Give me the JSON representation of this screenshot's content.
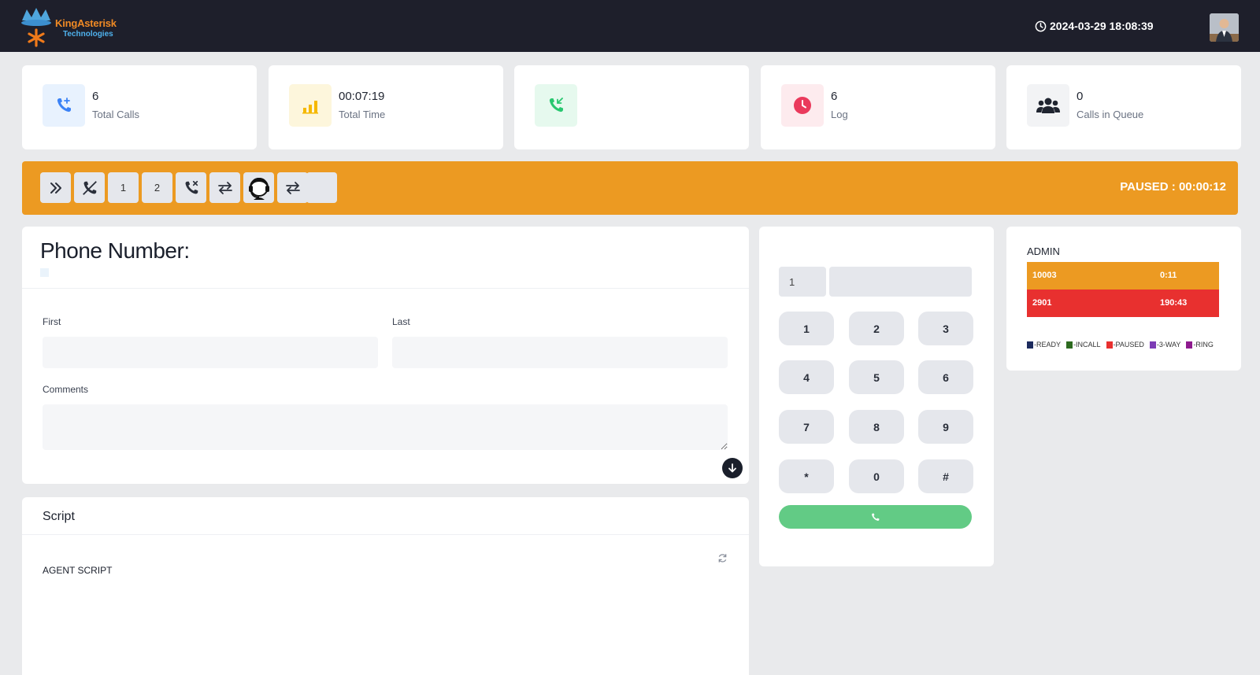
{
  "header": {
    "logo_brand": "KingAsterisk",
    "logo_sub": "Technologies",
    "datetime": "2024-03-29 18:08:39"
  },
  "stats": [
    {
      "value": "6",
      "label": "Total Calls",
      "icon": "phone-plus-icon",
      "color": "#3b82f6"
    },
    {
      "value": "00:07:19",
      "label": "Total Time",
      "icon": "bar-chart-icon",
      "color": "#f5b800"
    },
    {
      "value": "",
      "label": "",
      "icon": "incoming-call-icon",
      "color": "#28c76f"
    },
    {
      "value": "6",
      "label": "Log",
      "icon": "clock-icon",
      "color": "#ea3a5c"
    },
    {
      "value": "0",
      "label": "Calls in Queue",
      "icon": "users-icon",
      "color": "#1f2430"
    }
  ],
  "toolbar": {
    "buttons": [
      "next-icon",
      "hangup-icon",
      "1",
      "2",
      "call-missed-icon",
      "transfer-icon",
      "agent-headset-icon",
      "transfer-icon",
      ""
    ],
    "status": "PAUSED : 00:00:12",
    "bg_color": "#ec9a22"
  },
  "form": {
    "phone_label": "Phone Number:",
    "first_label": "First",
    "first_value": "",
    "last_label": "Last",
    "last_value": "",
    "comments_label": "Comments",
    "comments_value": ""
  },
  "dialpad": {
    "prefix": "1",
    "number": "",
    "keys": [
      "1",
      "2",
      "3",
      "4",
      "5",
      "6",
      "7",
      "8",
      "9",
      "*",
      "0",
      "#"
    ],
    "call_color": "#62cb85"
  },
  "admin": {
    "title": "ADMIN",
    "rows": [
      {
        "ext": "10003",
        "time": "0:11",
        "color": "#ec9a22"
      },
      {
        "ext": "2901",
        "time": "190:43",
        "color": "#e8302f"
      }
    ],
    "legend": [
      {
        "label": "-READY",
        "color": "#1d2b5e"
      },
      {
        "label": "-INCALL",
        "color": "#2d6a1f"
      },
      {
        "label": "-PAUSED",
        "color": "#e8302f"
      },
      {
        "label": "-3-WAY",
        "color": "#7d3cb5"
      },
      {
        "label": "-RING",
        "color": "#8e1a8e"
      }
    ]
  },
  "script": {
    "title": "Script",
    "text": "AGENT SCRIPT"
  }
}
